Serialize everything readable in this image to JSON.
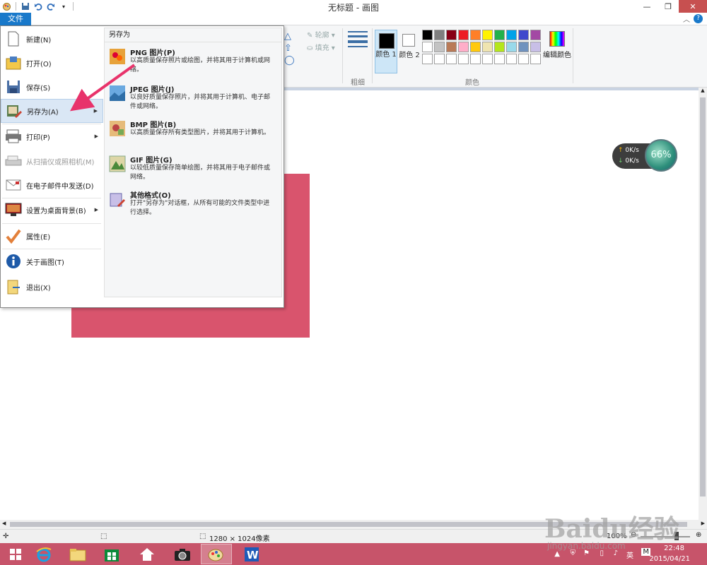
{
  "window": {
    "title": "无标题 - 画图"
  },
  "ribbon": {
    "file_tab": "文件",
    "outline_label": "轮廓",
    "fill_label": "填充",
    "thickness_label": "粗细",
    "color1_label": "颜色 1",
    "color2_label": "颜色 2",
    "edit_colors_label": "编辑颜色",
    "colors_group_label": "颜色",
    "palette": [
      "#000000",
      "#7f7f7f",
      "#880015",
      "#ed1c24",
      "#ff7f27",
      "#fff200",
      "#22b14c",
      "#00a2e8",
      "#3f48cc",
      "#a349a4",
      "#ffffff",
      "#c3c3c3",
      "#b97a57",
      "#ffaec9",
      "#ffc90e",
      "#efe4b0",
      "#b5e61d",
      "#99d9ea",
      "#7092be",
      "#c8bfe7",
      "#ffffff",
      "#ffffff",
      "#ffffff",
      "#ffffff",
      "#ffffff",
      "#ffffff",
      "#ffffff",
      "#ffffff",
      "#ffffff",
      "#ffffff"
    ]
  },
  "file_menu": {
    "items": [
      {
        "label": "新建(N)",
        "icon": "new-file-icon"
      },
      {
        "label": "打开(O)",
        "icon": "open-folder-icon"
      },
      {
        "label": "保存(S)",
        "icon": "save-icon"
      },
      {
        "label": "另存为(A)",
        "icon": "save-as-icon",
        "submenu": true,
        "selected": true
      },
      {
        "label": "打印(P)",
        "icon": "printer-icon",
        "submenu": true
      },
      {
        "label": "从扫描仪或照相机(M)",
        "icon": "scanner-icon",
        "disabled": true
      },
      {
        "label": "在电子邮件中发送(D)",
        "icon": "email-icon"
      },
      {
        "label": "设置为桌面背景(B)",
        "icon": "desktop-icon",
        "submenu": true
      },
      {
        "label": "属性(E)",
        "icon": "checkmark-icon"
      },
      {
        "label": "关于画图(T)",
        "icon": "info-icon"
      },
      {
        "label": "退出(X)",
        "icon": "exit-icon"
      }
    ],
    "save_as": {
      "title": "另存为",
      "options": [
        {
          "name": "PNG 图片(P)",
          "desc": "以高质量保存照片或绘图，并将其用于计算机或网络。",
          "icon": "png-icon"
        },
        {
          "name": "JPEG 图片(J)",
          "desc": "以良好质量保存照片，并将其用于计算机、电子邮件或网络。",
          "icon": "jpeg-icon"
        },
        {
          "name": "BMP 图片(B)",
          "desc": "以高质量保存所有类型图片，并将其用于计算机。",
          "icon": "bmp-icon"
        },
        {
          "name": "GIF 图片(G)",
          "desc": "以较低质量保存简单绘图，并将其用于电子邮件或网络。",
          "icon": "gif-icon"
        },
        {
          "name": "其他格式(O)",
          "desc": "打开\"另存为\"对话框，从所有可能的文件类型中进行选择。",
          "icon": "other-formats-icon"
        }
      ]
    }
  },
  "net_widget": {
    "up": "0K/s",
    "down": "0K/s",
    "percent": "66%"
  },
  "statusbar": {
    "image_size": "1280 × 1024像素",
    "zoom": "100%"
  },
  "tray": {
    "ime": "英",
    "ime2": "M",
    "time": "22:48",
    "date": "2015/04/21"
  },
  "watermark": {
    "brand": "Baidu经验",
    "url": "jingyan.baidu.com"
  }
}
